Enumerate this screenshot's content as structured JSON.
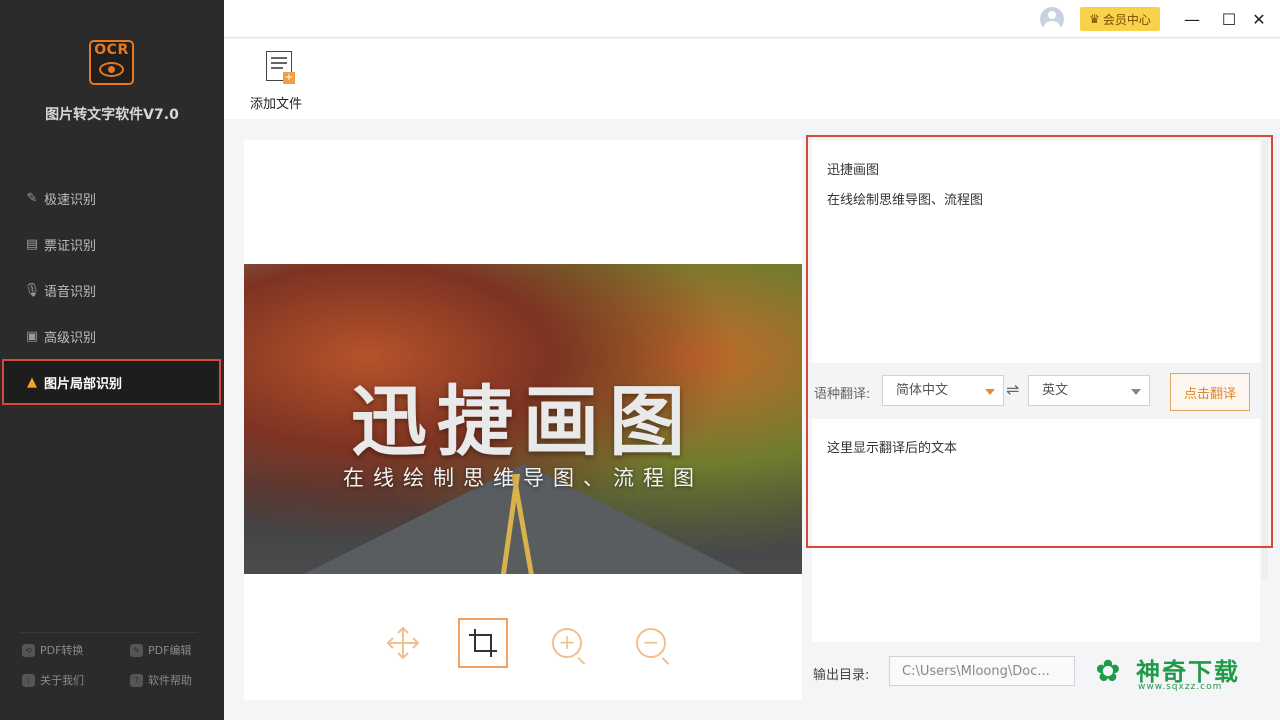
{
  "sidebar": {
    "logo_text": "OCR",
    "app_title": "图片转文字软件V7.0",
    "items": [
      {
        "label": "极速识别",
        "icon": "quick-scan-icon"
      },
      {
        "label": "票证识别",
        "icon": "ticket-icon"
      },
      {
        "label": "语音识别",
        "icon": "microphone-icon"
      },
      {
        "label": "高级识别",
        "icon": "advanced-scan-icon"
      },
      {
        "label": "图片局部识别",
        "icon": "image-crop-icon",
        "active": true
      }
    ],
    "footer": [
      {
        "label": "PDF转换",
        "icon": "pdf-convert-icon"
      },
      {
        "label": "PDF编辑",
        "icon": "pdf-edit-icon"
      },
      {
        "label": "关于我们",
        "icon": "about-icon"
      },
      {
        "label": "软件帮助",
        "icon": "help-icon"
      }
    ]
  },
  "titlebar": {
    "member_label": "会员中心",
    "minimize": "—",
    "maximize": "☐",
    "close": "✕"
  },
  "toolbar": {
    "add_file_label": "添加文件"
  },
  "preview": {
    "image_title": "迅捷画图",
    "image_subtitle": "在线绘制思维导图、流程图"
  },
  "result": {
    "lines": [
      "迅捷画图",
      "在线绘制思维导图、流程图"
    ]
  },
  "translate": {
    "label": "语种翻译:",
    "source_lang": "简体中文",
    "target_lang": "英文",
    "swap": "⇌",
    "button_label": "点击翻译",
    "output_placeholder": "这里显示翻译后的文本"
  },
  "output": {
    "label": "输出目录:",
    "path": "C:\\Users\\Mloong\\Doc..."
  },
  "watermark": {
    "name": "神奇下载",
    "url": "www.sqxzz.com"
  },
  "colors": {
    "accent": "#e8781c",
    "highlight_frame": "#d9463a",
    "member_gold": "#f7d24a"
  }
}
